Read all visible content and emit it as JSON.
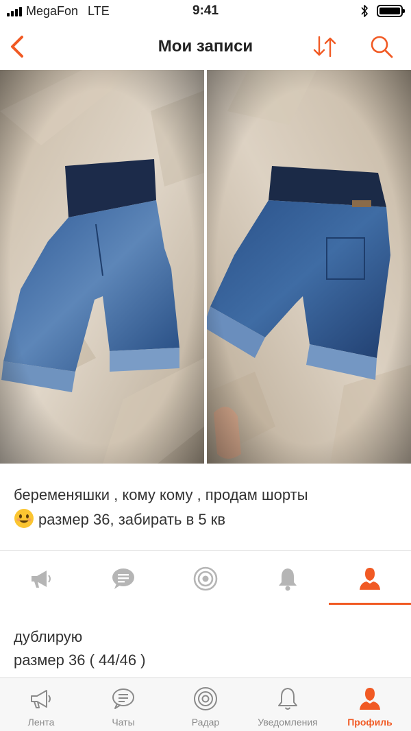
{
  "status_bar": {
    "carrier": "MegaFon",
    "network": "LTE",
    "time": "9:41"
  },
  "nav": {
    "title": "Мои записи",
    "icons": [
      "back-chevron-icon",
      "sort-arrows-icon",
      "search-icon"
    ]
  },
  "photos": [
    {
      "description": "front-photo"
    },
    {
      "description": "back-photo"
    }
  ],
  "post": {
    "line1": "беременяшки , кому кому , продам шорты",
    "line2": "размер 36,  забирать в 5 кв",
    "emoji": "smiling-face-icon"
  },
  "inner_tabs": [
    "megaphone-icon",
    "chat-icon",
    "radar-icon",
    "bell-icon",
    "profile-icon"
  ],
  "inner_tab_active": 4,
  "comment": {
    "line1": "дублирую",
    "line2": "размер 36 ( 44/46 )"
  },
  "tab_bar": {
    "items": [
      {
        "label": "Лента",
        "icon": "megaphone-icon"
      },
      {
        "label": "Чаты",
        "icon": "chat-icon"
      },
      {
        "label": "Радар",
        "icon": "radar-icon"
      },
      {
        "label": "Уведомления",
        "icon": "bell-icon"
      },
      {
        "label": "Профиль",
        "icon": "profile-icon"
      }
    ],
    "active_index": 4
  },
  "colors": {
    "accent": "#f15a24",
    "inactive_icon": "#b5b5b5",
    "inactive_label": "#8a8a8a"
  }
}
